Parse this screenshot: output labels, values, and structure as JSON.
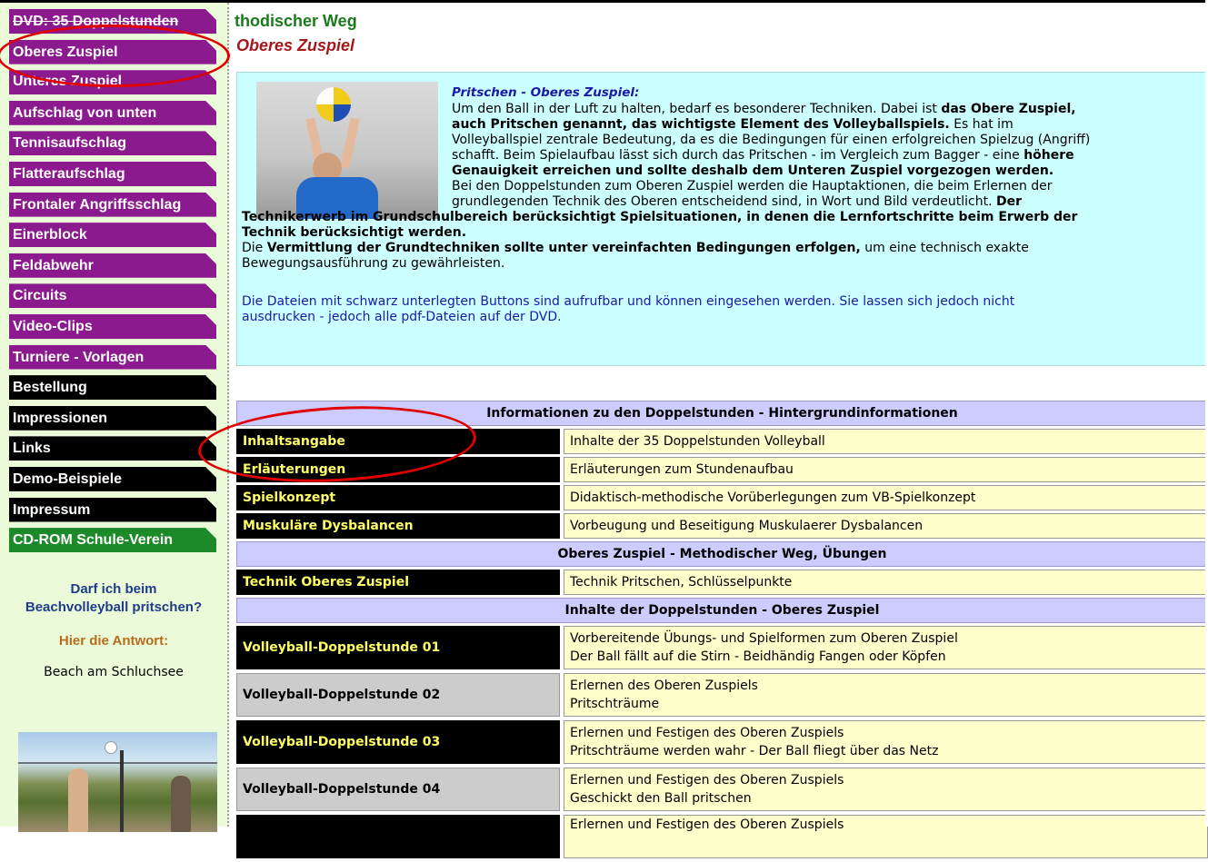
{
  "sidebar": {
    "items": [
      {
        "label": "DVD: 35 Doppelstunden",
        "color": "purple",
        "strike": true,
        "clipped": false
      },
      {
        "label": "Oberes Zuspiel",
        "color": "purple",
        "strike": false,
        "clipped": false
      },
      {
        "label": "Unteres Zuspiel",
        "color": "purple",
        "strike": false,
        "clipped": true
      },
      {
        "label": "Aufschlag von unten",
        "color": "purple",
        "strike": false,
        "clipped": false
      },
      {
        "label": "Tennisaufschlag",
        "color": "purple",
        "strike": false,
        "clipped": false
      },
      {
        "label": "Flatteraufschlag",
        "color": "purple",
        "strike": false,
        "clipped": false
      },
      {
        "label": "Frontaler Angriffsschlag",
        "color": "purple",
        "strike": false,
        "clipped": false
      },
      {
        "label": "Einerblock",
        "color": "purple",
        "strike": false,
        "clipped": false
      },
      {
        "label": "Feldabwehr",
        "color": "purple",
        "strike": false,
        "clipped": false
      },
      {
        "label": "Circuits",
        "color": "purple",
        "strike": false,
        "clipped": false
      },
      {
        "label": "Video-Clips",
        "color": "purple",
        "strike": false,
        "clipped": false
      },
      {
        "label": "Turniere - Vorlagen",
        "color": "purple",
        "strike": false,
        "clipped": false
      },
      {
        "label": "Bestellung",
        "color": "black",
        "strike": false,
        "clipped": false
      },
      {
        "label": "Impressionen",
        "color": "black",
        "strike": false,
        "clipped": false
      },
      {
        "label": "Links",
        "color": "black",
        "strike": false,
        "clipped": false
      },
      {
        "label": "Demo-Beispiele",
        "color": "black",
        "strike": false,
        "clipped": false
      },
      {
        "label": "Impressum",
        "color": "black",
        "strike": false,
        "clipped": false
      },
      {
        "label": "CD-ROM Schule-Verein",
        "color": "green",
        "strike": false,
        "clipped": false
      }
    ],
    "promo": {
      "question": "Darf ich beim Beachvolleyball pritschen?",
      "answer": "Hier die Antwort:",
      "place": "Beach am Schluchsee"
    }
  },
  "main": {
    "heading": "thodischer Weg",
    "subheading": "Oberes Zuspiel",
    "info": {
      "title": "Pritschen - Oberes Zuspiel:",
      "l1": "Um den Ball in der Luft zu halten, bedarf es besonderer Techniken. Dabei ist ",
      "l1b": "das Obere Zuspiel,",
      "l2b": "auch Pritschen genannt, das wichtigste Element des Volleyballspiels.",
      "l2": " Es hat im",
      "l3": "Volleyballspiel zentrale Bedeutung, da es die Bedingungen für einen erfolgreichen Spielzug (Angriff)",
      "l4": "schafft. Beim Spielaufbau lässt sich durch das Pritschen - im Vergleich zum Bagger - eine ",
      "l4b": "höhere",
      "l5b": "Genauigkeit erreichen und sollte deshalb dem Unteren Zuspiel vorgezogen werden.",
      "l6": "Bei den Doppelstunden zum Oberen Zuspiel werden die Hauptaktionen, die beim Erlernen der",
      "l7": "grundlegenden Technik des Oberen entscheidend sind, in Wort und Bild verdeutlicht. ",
      "l7b": "Der",
      "l8b": "Technikerwerb im Grundschulbereich berücksichtigt Spielsituationen, in denen die Lernfortschritte beim Erwerb der",
      "l9b": "Technik berücksichtigt werden.",
      "l10": "Die ",
      "l10b": "Vermittlung der Grundtechniken sollte unter vereinfachten Bedingungen erfolgen,",
      "l10c": " um eine technisch exakte",
      "l11": "Bewegungsausführung zu gewährleisten.",
      "n1": "Die Dateien mit schwarz unterlegten Buttons sind aufrufbar und können eingesehen werden. Sie lassen sich jedoch nicht",
      "n2": "ausdrucken - jedoch alle pdf-Dateien auf der DVD."
    },
    "table": {
      "h1": "Informationen zu den Doppelstunden - Hintergrundinformationen",
      "r1": {
        "left": "Inhaltsangabe",
        "right": "Inhalte der 35 Doppelstunden Volleyball"
      },
      "r2": {
        "left": "Erläuterungen",
        "right": "Erläuterungen zum Stundenaufbau"
      },
      "r3": {
        "left": "Spielkonzept",
        "right": "Didaktisch-methodische Vorüberlegungen zum VB-Spielkonzept"
      },
      "r4": {
        "left": "Muskuläre Dysbalancen",
        "right": "Vorbeugung und Beseitigung Muskulaerer Dysbalancen"
      },
      "h2": "Oberes Zuspiel - Methodischer Weg, Übungen",
      "r5": {
        "left": "Technik Oberes Zuspiel",
        "right": "Technik Pritschen, Schlüsselpunkte"
      },
      "h3": "Inhalte der Doppelstunden - Oberes Zuspiel",
      "d1": {
        "left": "Volleyball-Doppelstunde 01",
        "r1": "Vorbereitende Übungs- und Spielformen zum Oberen Zuspiel",
        "r2": "Der Ball fällt auf die Stirn - Beidhändig Fangen oder Köpfen"
      },
      "d2": {
        "left": "Volleyball-Doppelstunde 02",
        "r1": "Erlernen des Oberen Zuspiels",
        "r2": "Pritschträume"
      },
      "d3": {
        "left": "Volleyball-Doppelstunde 03",
        "r1": "Erlernen und Festigen des Oberen Zuspiels",
        "r2": "Pritschträume werden wahr - Der Ball fliegt über das Netz"
      },
      "d4": {
        "left": "Volleyball-Doppelstunde 04",
        "r1": "Erlernen und Festigen des Oberen Zuspiels",
        "r2": "Geschickt den Ball pritschen"
      },
      "d5": {
        "left": "",
        "r1": "Erlernen und Festigen des Oberen Zuspiels",
        "r2": ""
      }
    }
  },
  "colors": {
    "nav_purple": "#8b1a8f",
    "nav_black": "#000000",
    "nav_green": "#1d8a29",
    "sidebar_bg": "#ebfbd9",
    "info_bg": "#ccffff",
    "header_bg": "#ccccff",
    "cell_bg": "#ffffcc",
    "highlight_red": "#e00000"
  }
}
